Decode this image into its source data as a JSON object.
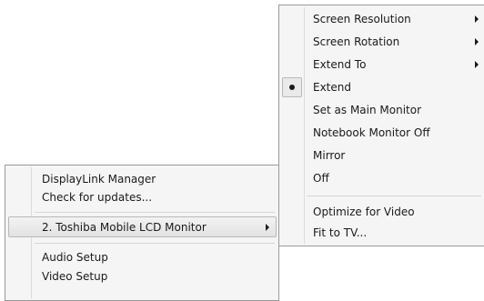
{
  "left_menu": {
    "items": [
      {
        "label": "DisplayLink Manager"
      },
      {
        "label": "Check for updates..."
      },
      {
        "label": "2. Toshiba Mobile LCD Monitor",
        "submenu": true,
        "highlighted": true
      },
      {
        "label": "Audio Setup"
      },
      {
        "label": "Video Setup"
      }
    ]
  },
  "right_menu": {
    "items": [
      {
        "label": "Screen Resolution",
        "submenu": true
      },
      {
        "label": "Screen Rotation",
        "submenu": true
      },
      {
        "label": "Extend To",
        "submenu": true
      },
      {
        "label": "Extend",
        "selected": true
      },
      {
        "label": "Set as Main Monitor"
      },
      {
        "label": "Notebook Monitor Off"
      },
      {
        "label": "Mirror"
      },
      {
        "label": "Off"
      },
      {
        "label": "Optimize for Video"
      },
      {
        "label": "Fit to TV..."
      }
    ]
  }
}
